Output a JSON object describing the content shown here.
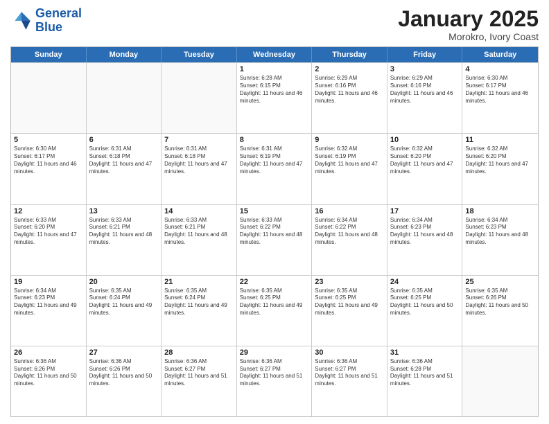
{
  "header": {
    "logo_line1": "General",
    "logo_line2": "Blue",
    "title": "January 2025",
    "subtitle": "Morokro, Ivory Coast"
  },
  "days_of_week": [
    "Sunday",
    "Monday",
    "Tuesday",
    "Wednesday",
    "Thursday",
    "Friday",
    "Saturday"
  ],
  "weeks": [
    [
      {
        "day": "",
        "empty": true
      },
      {
        "day": "",
        "empty": true
      },
      {
        "day": "",
        "empty": true
      },
      {
        "day": "1",
        "sunrise": "6:28 AM",
        "sunset": "6:15 PM",
        "daylight": "11 hours and 46 minutes."
      },
      {
        "day": "2",
        "sunrise": "6:29 AM",
        "sunset": "6:16 PM",
        "daylight": "11 hours and 46 minutes."
      },
      {
        "day": "3",
        "sunrise": "6:29 AM",
        "sunset": "6:16 PM",
        "daylight": "11 hours and 46 minutes."
      },
      {
        "day": "4",
        "sunrise": "6:30 AM",
        "sunset": "6:17 PM",
        "daylight": "11 hours and 46 minutes."
      }
    ],
    [
      {
        "day": "5",
        "sunrise": "6:30 AM",
        "sunset": "6:17 PM",
        "daylight": "11 hours and 46 minutes."
      },
      {
        "day": "6",
        "sunrise": "6:31 AM",
        "sunset": "6:18 PM",
        "daylight": "11 hours and 47 minutes."
      },
      {
        "day": "7",
        "sunrise": "6:31 AM",
        "sunset": "6:18 PM",
        "daylight": "11 hours and 47 minutes."
      },
      {
        "day": "8",
        "sunrise": "6:31 AM",
        "sunset": "6:19 PM",
        "daylight": "11 hours and 47 minutes."
      },
      {
        "day": "9",
        "sunrise": "6:32 AM",
        "sunset": "6:19 PM",
        "daylight": "11 hours and 47 minutes."
      },
      {
        "day": "10",
        "sunrise": "6:32 AM",
        "sunset": "6:20 PM",
        "daylight": "11 hours and 47 minutes."
      },
      {
        "day": "11",
        "sunrise": "6:32 AM",
        "sunset": "6:20 PM",
        "daylight": "11 hours and 47 minutes."
      }
    ],
    [
      {
        "day": "12",
        "sunrise": "6:33 AM",
        "sunset": "6:20 PM",
        "daylight": "11 hours and 47 minutes."
      },
      {
        "day": "13",
        "sunrise": "6:33 AM",
        "sunset": "6:21 PM",
        "daylight": "11 hours and 48 minutes."
      },
      {
        "day": "14",
        "sunrise": "6:33 AM",
        "sunset": "6:21 PM",
        "daylight": "11 hours and 48 minutes."
      },
      {
        "day": "15",
        "sunrise": "6:33 AM",
        "sunset": "6:22 PM",
        "daylight": "11 hours and 48 minutes."
      },
      {
        "day": "16",
        "sunrise": "6:34 AM",
        "sunset": "6:22 PM",
        "daylight": "11 hours and 48 minutes."
      },
      {
        "day": "17",
        "sunrise": "6:34 AM",
        "sunset": "6:23 PM",
        "daylight": "11 hours and 48 minutes."
      },
      {
        "day": "18",
        "sunrise": "6:34 AM",
        "sunset": "6:23 PM",
        "daylight": "11 hours and 48 minutes."
      }
    ],
    [
      {
        "day": "19",
        "sunrise": "6:34 AM",
        "sunset": "6:23 PM",
        "daylight": "11 hours and 49 minutes."
      },
      {
        "day": "20",
        "sunrise": "6:35 AM",
        "sunset": "6:24 PM",
        "daylight": "11 hours and 49 minutes."
      },
      {
        "day": "21",
        "sunrise": "6:35 AM",
        "sunset": "6:24 PM",
        "daylight": "11 hours and 49 minutes."
      },
      {
        "day": "22",
        "sunrise": "6:35 AM",
        "sunset": "6:25 PM",
        "daylight": "11 hours and 49 minutes."
      },
      {
        "day": "23",
        "sunrise": "6:35 AM",
        "sunset": "6:25 PM",
        "daylight": "11 hours and 49 minutes."
      },
      {
        "day": "24",
        "sunrise": "6:35 AM",
        "sunset": "6:25 PM",
        "daylight": "11 hours and 50 minutes."
      },
      {
        "day": "25",
        "sunrise": "6:35 AM",
        "sunset": "6:26 PM",
        "daylight": "11 hours and 50 minutes."
      }
    ],
    [
      {
        "day": "26",
        "sunrise": "6:36 AM",
        "sunset": "6:26 PM",
        "daylight": "11 hours and 50 minutes."
      },
      {
        "day": "27",
        "sunrise": "6:36 AM",
        "sunset": "6:26 PM",
        "daylight": "11 hours and 50 minutes."
      },
      {
        "day": "28",
        "sunrise": "6:36 AM",
        "sunset": "6:27 PM",
        "daylight": "11 hours and 51 minutes."
      },
      {
        "day": "29",
        "sunrise": "6:36 AM",
        "sunset": "6:27 PM",
        "daylight": "11 hours and 51 minutes."
      },
      {
        "day": "30",
        "sunrise": "6:36 AM",
        "sunset": "6:27 PM",
        "daylight": "11 hours and 51 minutes."
      },
      {
        "day": "31",
        "sunrise": "6:36 AM",
        "sunset": "6:28 PM",
        "daylight": "11 hours and 51 minutes."
      },
      {
        "day": "",
        "empty": true
      }
    ]
  ]
}
